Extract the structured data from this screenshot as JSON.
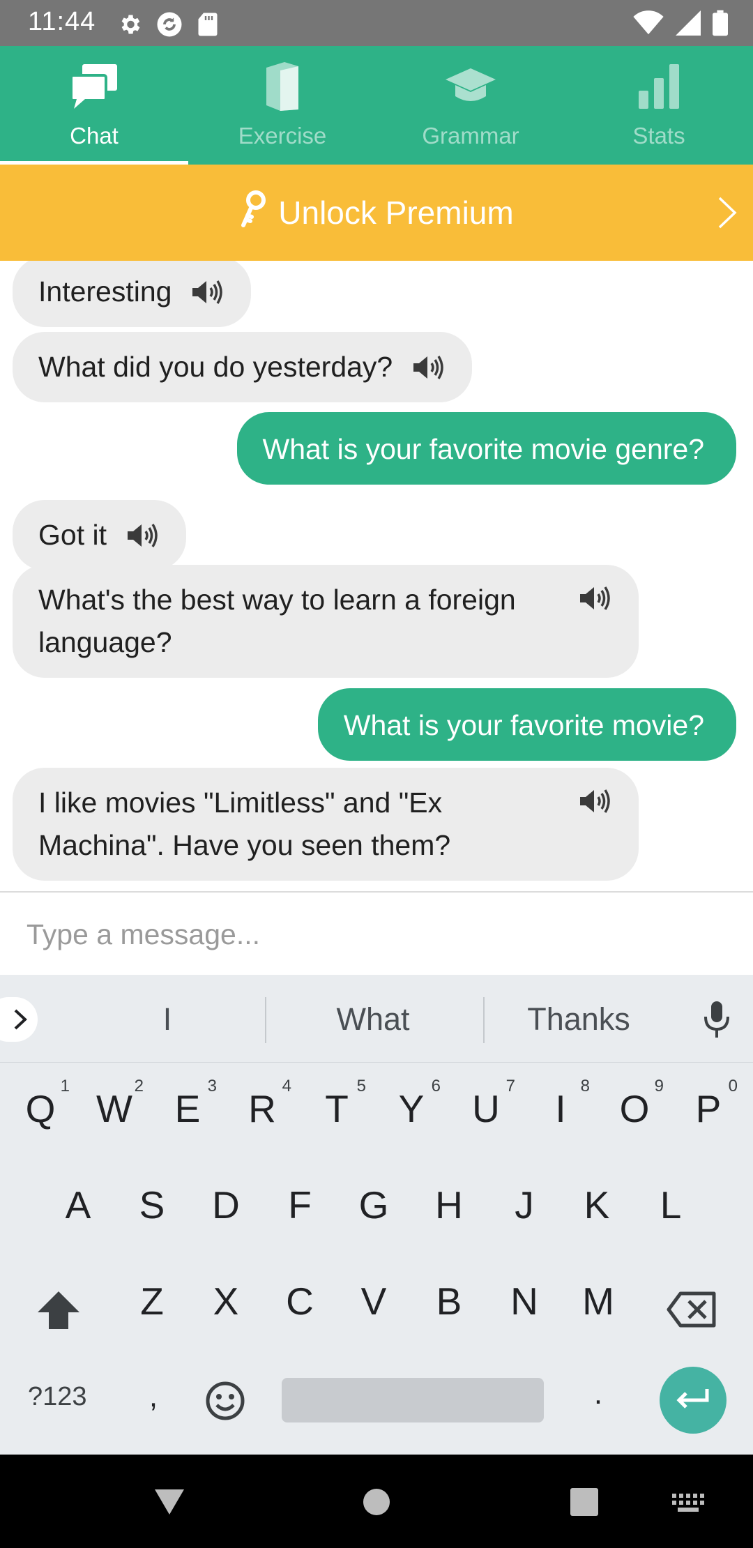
{
  "status_bar": {
    "time": "11:44"
  },
  "tabs": [
    {
      "label": "Chat",
      "icon": "chat-icon",
      "active": true
    },
    {
      "label": "Exercise",
      "icon": "book-icon",
      "active": false
    },
    {
      "label": "Grammar",
      "icon": "graduation-cap-icon",
      "active": false
    },
    {
      "label": "Stats",
      "icon": "bar-chart-icon",
      "active": false
    }
  ],
  "premium": {
    "label": "Unlock Premium"
  },
  "messages": [
    {
      "from": "bot",
      "text": "Interesting"
    },
    {
      "from": "bot",
      "text": "What did you do yesterday?"
    },
    {
      "from": "user",
      "text": "What is your favorite movie genre?"
    },
    {
      "from": "bot",
      "text": "Got it"
    },
    {
      "from": "bot",
      "line1": "What's the best way to learn a foreign",
      "line2": "language?"
    },
    {
      "from": "user",
      "text": "What is your favorite movie?"
    },
    {
      "from": "bot",
      "line1": "I like movies \"Limitless\" and \"Ex",
      "line2": "Machina\". Have you seen them?"
    }
  ],
  "input": {
    "placeholder": "Type a message..."
  },
  "keyboard": {
    "suggestions": [
      "I",
      "What",
      "Thanks"
    ],
    "row1": [
      {
        "key": "Q",
        "hint": "1"
      },
      {
        "key": "W",
        "hint": "2"
      },
      {
        "key": "E",
        "hint": "3"
      },
      {
        "key": "R",
        "hint": "4"
      },
      {
        "key": "T",
        "hint": "5"
      },
      {
        "key": "Y",
        "hint": "6"
      },
      {
        "key": "U",
        "hint": "7"
      },
      {
        "key": "I",
        "hint": "8"
      },
      {
        "key": "O",
        "hint": "9"
      },
      {
        "key": "P",
        "hint": "0"
      }
    ],
    "row2": [
      "A",
      "S",
      "D",
      "F",
      "G",
      "H",
      "J",
      "K",
      "L"
    ],
    "row3": [
      "Z",
      "X",
      "C",
      "V",
      "B",
      "N",
      "M"
    ],
    "symbols_label": "?123",
    "comma": ",",
    "period": "."
  },
  "colors": {
    "brand_green": "#2eb287",
    "premium_yellow": "#f9bd39",
    "bubble_gray": "#ececec"
  }
}
